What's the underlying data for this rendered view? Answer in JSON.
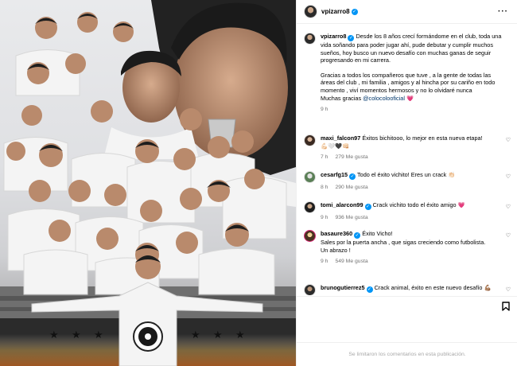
{
  "colors": {
    "accent": "#0095f6",
    "heart": "#ed4956",
    "mention": "#00376b",
    "muted": "#737373"
  },
  "post": {
    "author": "vpizarro8",
    "caption": {
      "text1": "Desde los 8 años crecí formándome en el club, toda una vida soñando para poder jugar ahí, pude debutar y cumplir muchos sueños, hoy busco un nuevo desafío con muchas ganas de seguir progresando en mi carrera.",
      "text2": "Gracias a todos los compañeros que tuve , a la gente de todas las áreas del club , mi familia , amigos y al hincha por su cariño en todo momento , viví momentos hermosos y no lo olvidaré nunca",
      "text3_prefix": "Muchas gracias",
      "mention": "@colocolooficial",
      "emoji": "💗",
      "time": "9 h"
    }
  },
  "comments": [
    {
      "user": "maxi_falcon97",
      "text": "Éxitos bichitooo, lo mejor en esta nueva etapa!",
      "extra": "💪🏻🤍🖤👊🏻",
      "time": "7 h",
      "likes": "279 Me gusta"
    },
    {
      "user": "cesarfg15",
      "verified": true,
      "text": "Todo el éxito vichito! Eres un crack 👏🏻",
      "time": "8 h",
      "likes": "290 Me gusta"
    },
    {
      "user": "tomi_alarcon99",
      "verified": true,
      "text": "Crack vichito todo el éxito amigo 💗",
      "time": "9 h",
      "likes": "936 Me gusta"
    },
    {
      "user": "basaure360",
      "verified": true,
      "text": "Éxito Vicho!",
      "text_b": "Sales por la puerta ancha , que sigas creciendo como futbolista.",
      "text_c": "Un abrazo !",
      "time": "9 h",
      "likes": "549 Me gusta"
    },
    {
      "user": "brunogutierrez5",
      "verified": true,
      "text": "Crack animal, éxito en este nuevo desafío 💪🏽"
    }
  ],
  "footer": {
    "text": "Se limitaron los comentarios en esta publicación."
  },
  "icons": {
    "more": "more-options-icon",
    "like": "heart-outline-icon",
    "save": "bookmark-icon",
    "verified": "verified-badge-icon"
  }
}
